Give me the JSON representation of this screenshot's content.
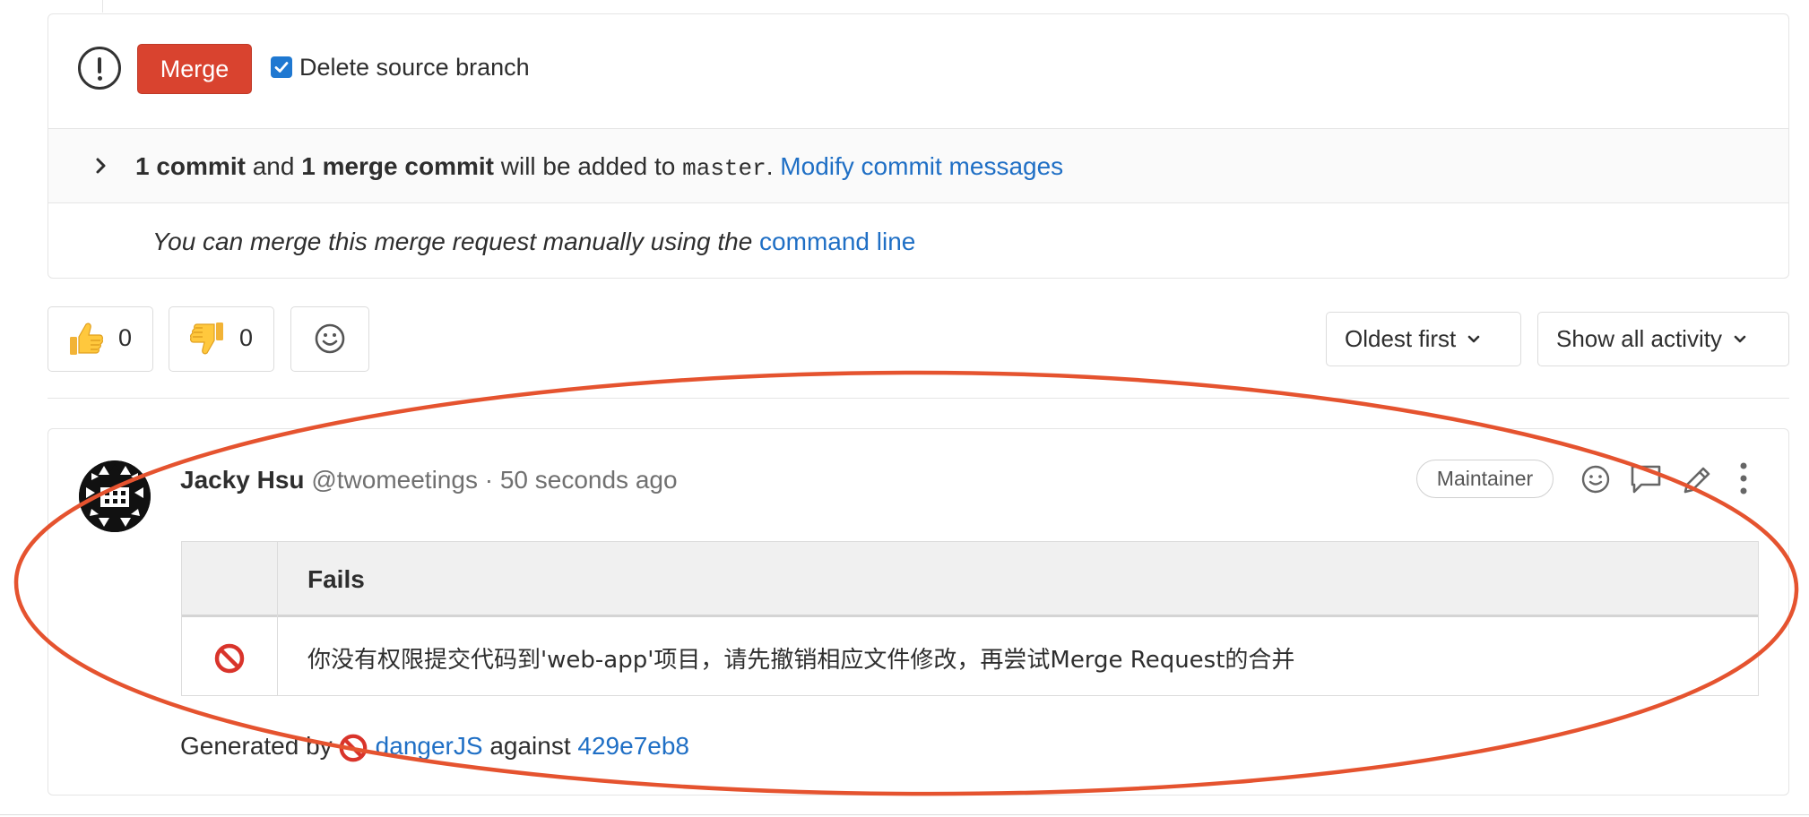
{
  "merge_widget": {
    "merge_label": "Merge",
    "delete_branch_label": "Delete source branch",
    "delete_branch_checked": true,
    "commit_info": {
      "commits": "1 commit",
      "and": "and",
      "merge_commit": "1 merge commit",
      "will_be_added": "will be added to",
      "branch": "master",
      "period": ".",
      "modify_link": "Modify commit messages"
    },
    "manual_merge": {
      "text": "You can merge this merge request manually using the",
      "link": "command line"
    }
  },
  "awards": {
    "thumbs_up_count": "0",
    "thumbs_down_count": "0"
  },
  "sort": {
    "order_label": "Oldest first",
    "filter_label": "Show all activity"
  },
  "note": {
    "author_name": "Jacky Hsu",
    "author_handle": "@twomeetings",
    "separator": "·",
    "time": "50 seconds ago",
    "role_badge": "Maintainer",
    "table": {
      "header": "Fails",
      "rows": [
        {
          "message": "你没有权限提交代码到'web-app'项目，请先撤销相应文件修改，再尝试Merge Request的合并"
        }
      ]
    },
    "footer": {
      "generated_by": "Generated by",
      "tool_link": "dangerJS",
      "against": "against",
      "commit_link": "429e7eb8"
    }
  },
  "colors": {
    "merge_button": "#d9432f",
    "link": "#1f6fc5",
    "annotation_ellipse": "#e5532f",
    "checkbox": "#1f78d1"
  }
}
